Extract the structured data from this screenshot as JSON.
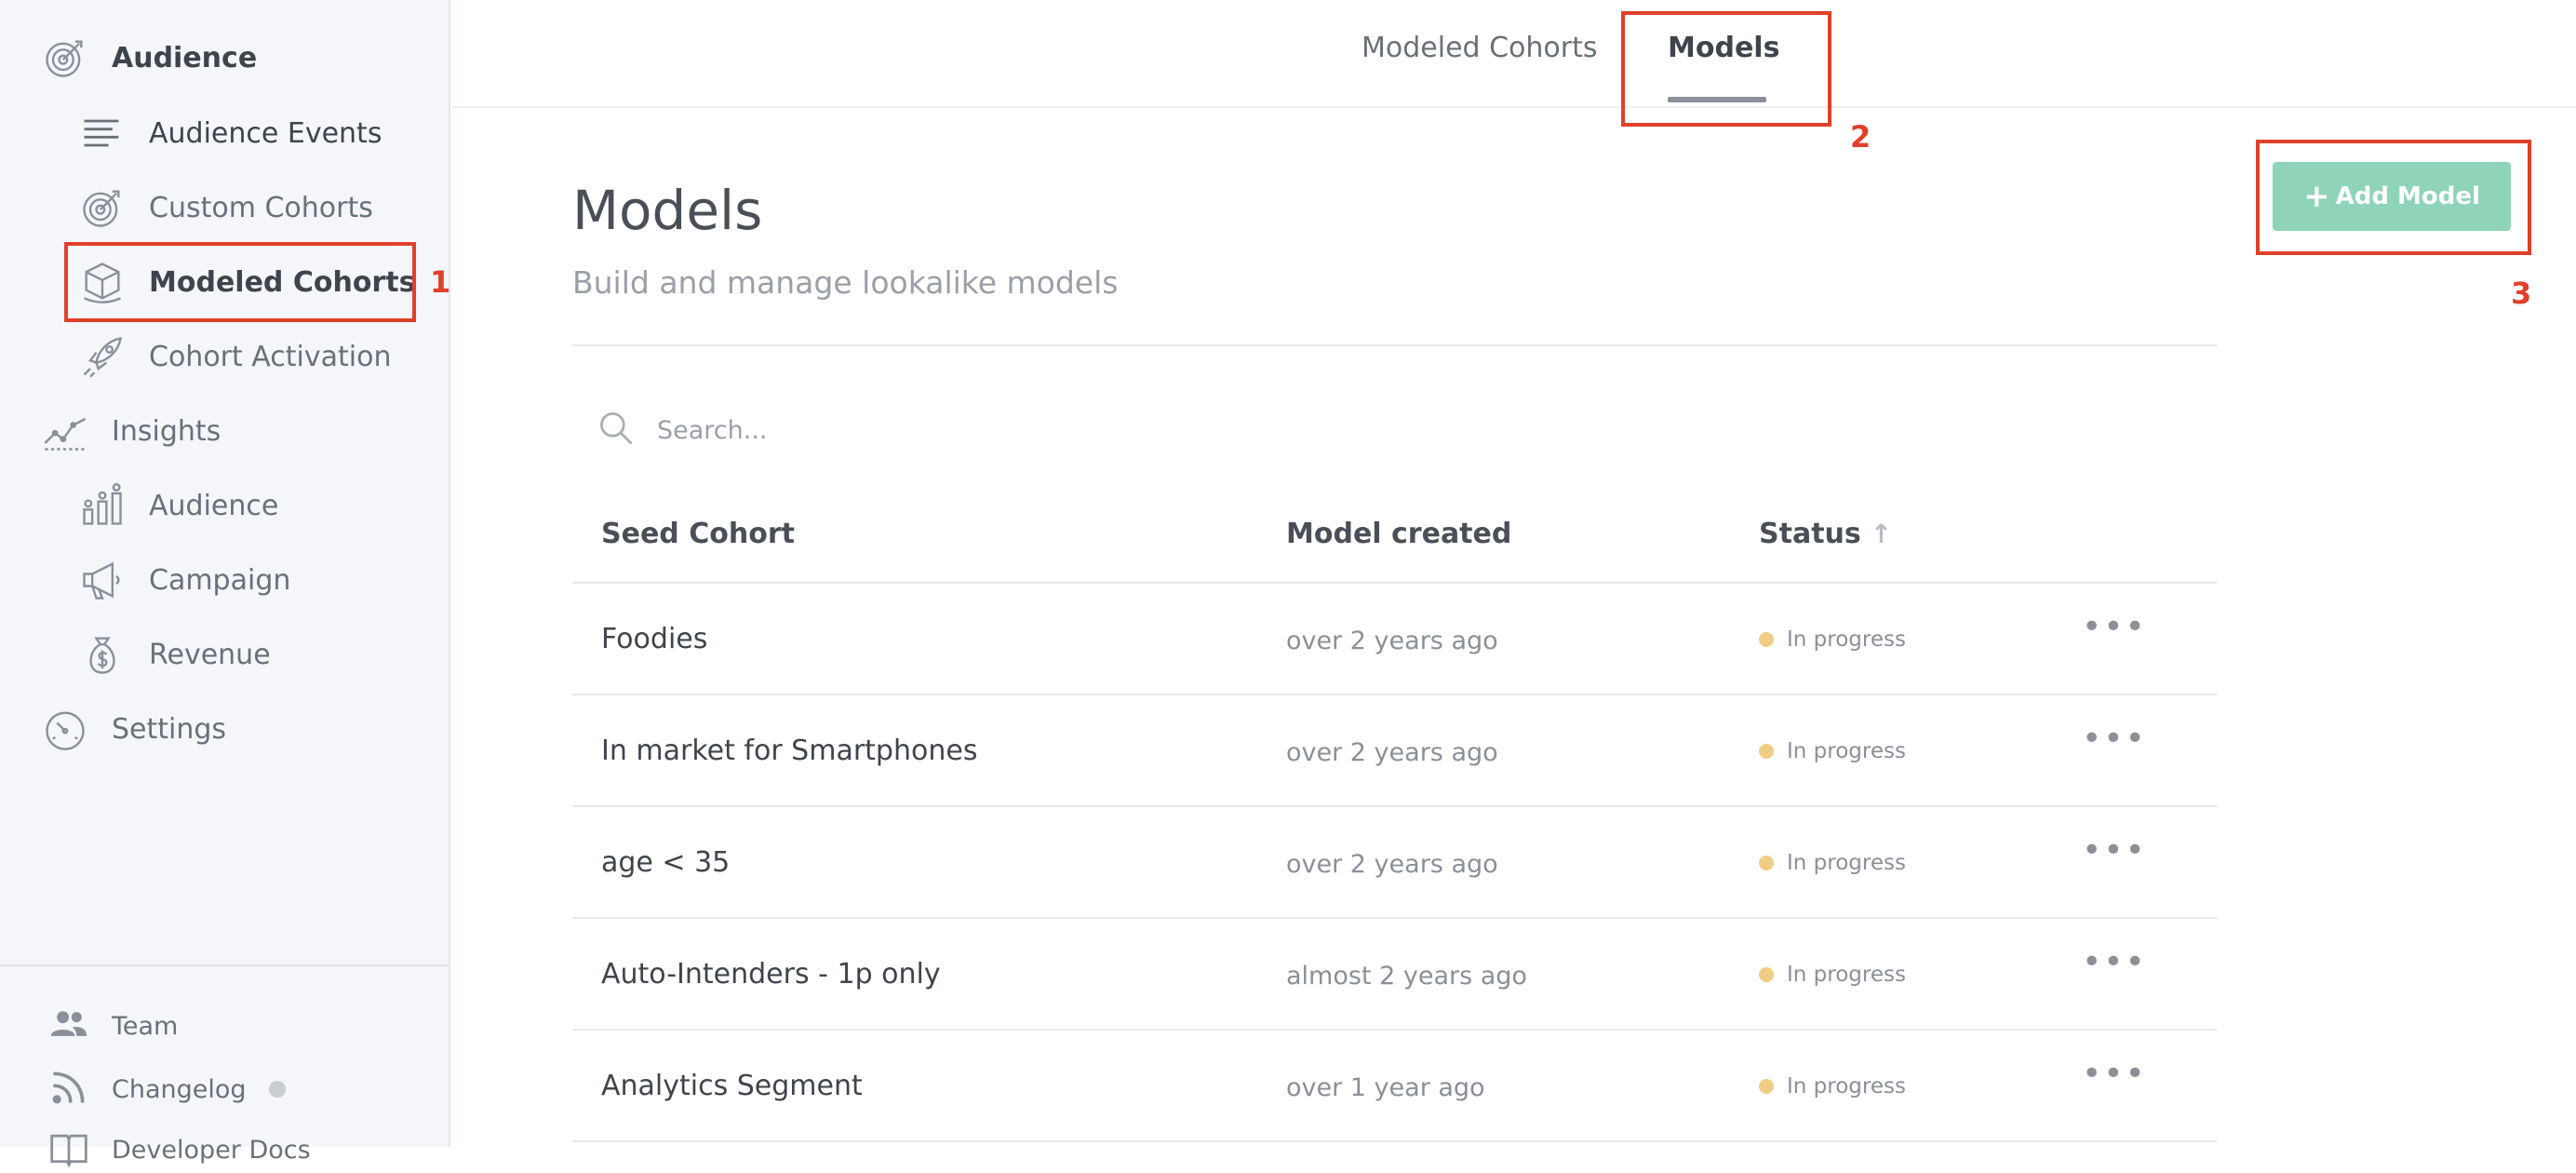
{
  "sidebar": {
    "items": [
      {
        "label": "Audience",
        "icon": "target-icon"
      },
      {
        "label": "Audience Events",
        "icon": "list-lines-icon"
      },
      {
        "label": "Custom Cohorts",
        "icon": "target-icon"
      },
      {
        "label": "Modeled Cohorts",
        "icon": "cube-icon"
      },
      {
        "label": "Cohort Activation",
        "icon": "rocket-icon"
      },
      {
        "label": "Insights",
        "icon": "trend-chart-icon"
      },
      {
        "label": "Audience",
        "icon": "bar-people-icon"
      },
      {
        "label": "Campaign",
        "icon": "megaphone-icon"
      },
      {
        "label": "Revenue",
        "icon": "money-bag-icon"
      },
      {
        "label": "Settings",
        "icon": "gauge-icon"
      }
    ],
    "footer": [
      {
        "label": "Team",
        "icon": "people-icon"
      },
      {
        "label": "Changelog",
        "icon": "rss-icon"
      },
      {
        "label": "Developer Docs",
        "icon": "book-icon"
      }
    ]
  },
  "annotations": [
    "1",
    "2",
    "3"
  ],
  "tabs": [
    {
      "label": "Modeled Cohorts"
    },
    {
      "label": "Models"
    }
  ],
  "header": {
    "title": "Models",
    "subtitle": "Build and manage lookalike models",
    "add_button": "Add Model",
    "add_button_plus": "+"
  },
  "search": {
    "placeholder": "Search..."
  },
  "table": {
    "columns": [
      "Seed Cohort",
      "Model created",
      "Status"
    ],
    "sort_indicator": "↑",
    "rows": [
      {
        "name": "Foodies",
        "created": "over 2 years ago",
        "status": "In progress",
        "actions": "•••"
      },
      {
        "name": "In market for Smartphones",
        "created": "over 2 years ago",
        "status": "In progress",
        "actions": "•••"
      },
      {
        "name": "age < 35",
        "created": "over 2 years ago",
        "status": "In progress",
        "actions": "•••"
      },
      {
        "name": "Auto-Intenders - 1p only",
        "created": "almost 2 years ago",
        "status": "In progress",
        "actions": "•••"
      },
      {
        "name": "Analytics Segment",
        "created": "over 1 year ago",
        "status": "In progress",
        "actions": "•••"
      }
    ]
  },
  "colors": {
    "annotation": "#e0402a",
    "button_bg": "#8fd4b8",
    "status_dot": "#f0cd84",
    "sidebar_bg": "#f4f6f9"
  }
}
